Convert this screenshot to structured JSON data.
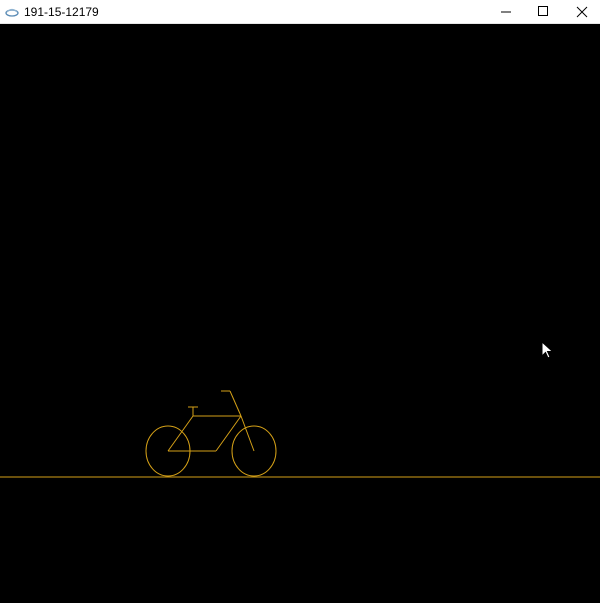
{
  "window": {
    "title": "191-15-12179"
  },
  "scene": {
    "line_color": "#d4a017",
    "background": "#000000",
    "object": "bicycle"
  },
  "icons": {
    "app": "app-icon",
    "minimize": "minimize-icon",
    "maximize": "maximize-icon",
    "close": "close-icon",
    "cursor": "mouse-pointer-icon"
  }
}
